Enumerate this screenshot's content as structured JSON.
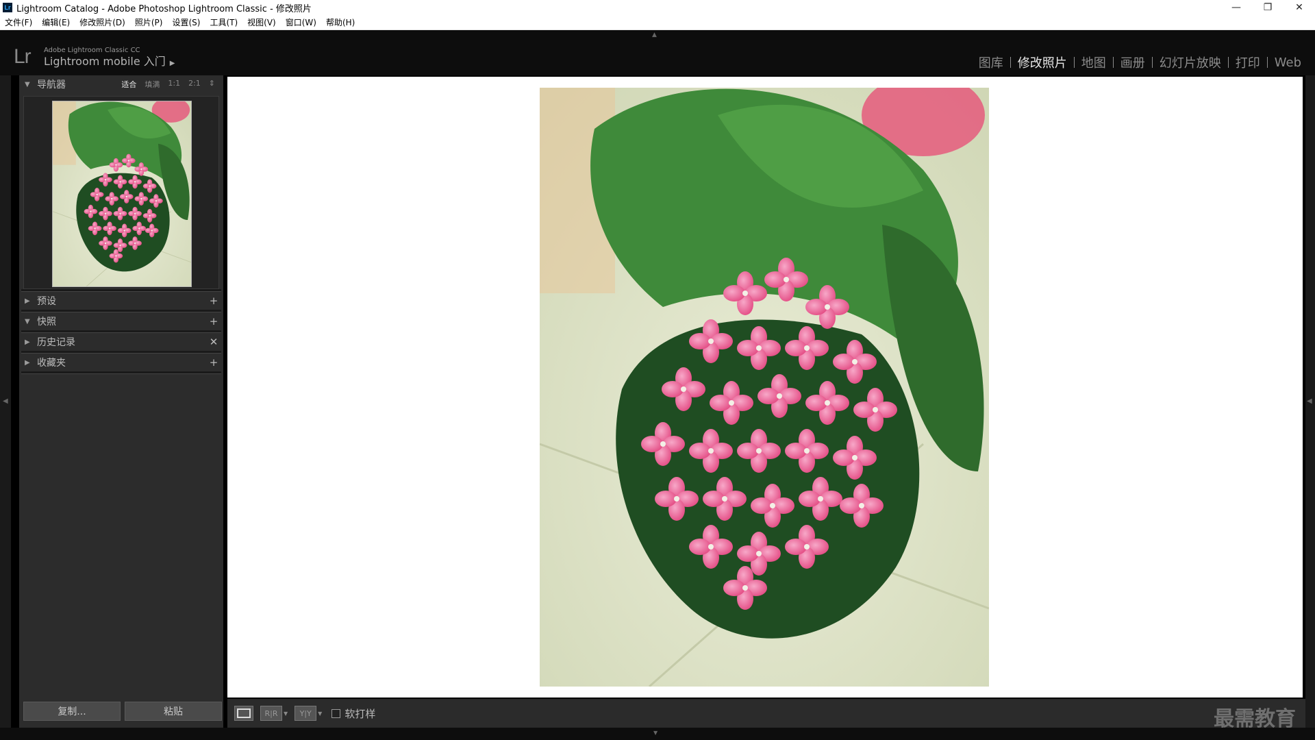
{
  "titlebar": {
    "icon": "Lr",
    "title": "Lightroom Catalog - Adobe Photoshop Lightroom Classic - 修改照片",
    "minimize": "—",
    "restore": "❐",
    "close": "✕"
  },
  "menu": [
    "文件(F)",
    "编辑(E)",
    "修改照片(D)",
    "照片(P)",
    "设置(S)",
    "工具(T)",
    "视图(V)",
    "窗口(W)",
    "帮助(H)"
  ],
  "identity": {
    "logo": "Lr",
    "product": "Adobe Lightroom Classic CC",
    "mobile": "Lightroom mobile 入门",
    "play": "▶"
  },
  "modules": [
    "图库",
    "修改照片",
    "地图",
    "画册",
    "幻灯片放映",
    "打印",
    "Web"
  ],
  "active_module": "修改照片",
  "navigator": {
    "title": "导航器",
    "zoom_options": [
      "适合",
      "填满",
      "1:1",
      "2:1"
    ],
    "zoom_selected": "适合",
    "zoom_arrow": "⇕"
  },
  "panels": [
    {
      "title": "预设",
      "expanded": false,
      "action": "+"
    },
    {
      "title": "快照",
      "expanded": true,
      "action": "+"
    },
    {
      "title": "历史记录",
      "expanded": false,
      "action": "✕"
    },
    {
      "title": "收藏夹",
      "expanded": false,
      "action": "+"
    }
  ],
  "left_buttons": {
    "copy": "复制...",
    "paste": "粘贴"
  },
  "toolbar": {
    "ba_label": "R|R",
    "yy_label": "Y|Y",
    "soft_proof": "软打样",
    "soft_proof_checked": false
  },
  "watermark": "最需教育",
  "colors": {
    "accent_bg": "#0d0d0d",
    "panel": "#2c2c2c",
    "flower_pink": "#e94b8a",
    "leaf_green": "#2f6b2c"
  }
}
